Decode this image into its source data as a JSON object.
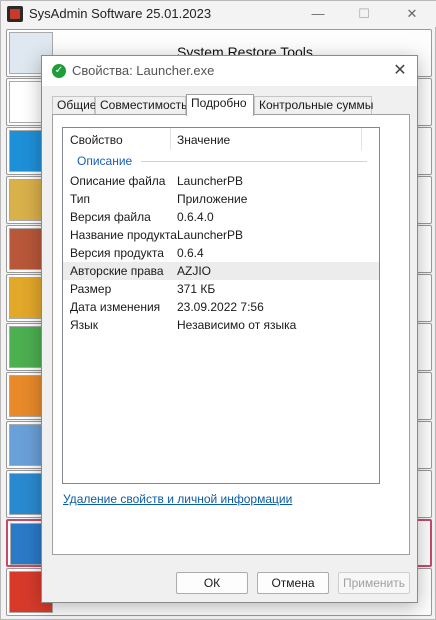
{
  "app": {
    "title": "SysAdmin Software 25.01.2023",
    "controls": {
      "minimize": "—",
      "maximize": "☐",
      "close": "✕"
    },
    "buttons": [
      {
        "label": "System Restore Tools",
        "icon": "restore-tools-icon"
      },
      {
        "label": "",
        "icon": "sys-file-icon"
      },
      {
        "label": "",
        "icon": "windows-logo-icon"
      },
      {
        "label": "",
        "icon": "ms-tools-icon"
      },
      {
        "label": "",
        "icon": "settings-panel-icon"
      },
      {
        "label": "",
        "icon": "sliders-icon"
      },
      {
        "label": "",
        "icon": "info-icon"
      },
      {
        "label": "",
        "icon": "transfer-icon"
      },
      {
        "label": "",
        "icon": "network-computer-icon"
      },
      {
        "label": "",
        "icon": "remote-desktop-icon"
      },
      {
        "label": "",
        "icon": "refresh-sync-icon"
      },
      {
        "label": "",
        "icon": "joystick-icon"
      }
    ]
  },
  "dialog": {
    "title": "Свойства: Launcher.exe",
    "close": "✕",
    "tabs": [
      "Общие",
      "Совместимость",
      "Подробно",
      "Контрольные суммы"
    ],
    "active_tab": "Подробно",
    "columns": {
      "property": "Свойство",
      "value": "Значение"
    },
    "group": "Описание",
    "rows": [
      {
        "key": "Описание файла",
        "value": "LauncherPB"
      },
      {
        "key": "Тип",
        "value": "Приложение"
      },
      {
        "key": "Версия файла",
        "value": "0.6.4.0"
      },
      {
        "key": "Название продукта",
        "value": "LauncherPB"
      },
      {
        "key": "Версия продукта",
        "value": "0.6.4"
      },
      {
        "key": "Авторские права",
        "value": "AZJIO"
      },
      {
        "key": "Размер",
        "value": "371 КБ"
      },
      {
        "key": "Дата изменения",
        "value": "23.09.2022 7:56"
      },
      {
        "key": "Язык",
        "value": "Независимо от языка"
      }
    ],
    "selected_row": "Авторские права",
    "remove_link": "Удаление свойств и личной информации",
    "ok": "ОК",
    "cancel": "Отмена",
    "apply": "Применить"
  },
  "colors": {
    "accent_link": "#0a5ca8",
    "group_label": "#1a5fb4",
    "shield": "#1f9d3a",
    "highlight_border": "#c84a6a"
  }
}
